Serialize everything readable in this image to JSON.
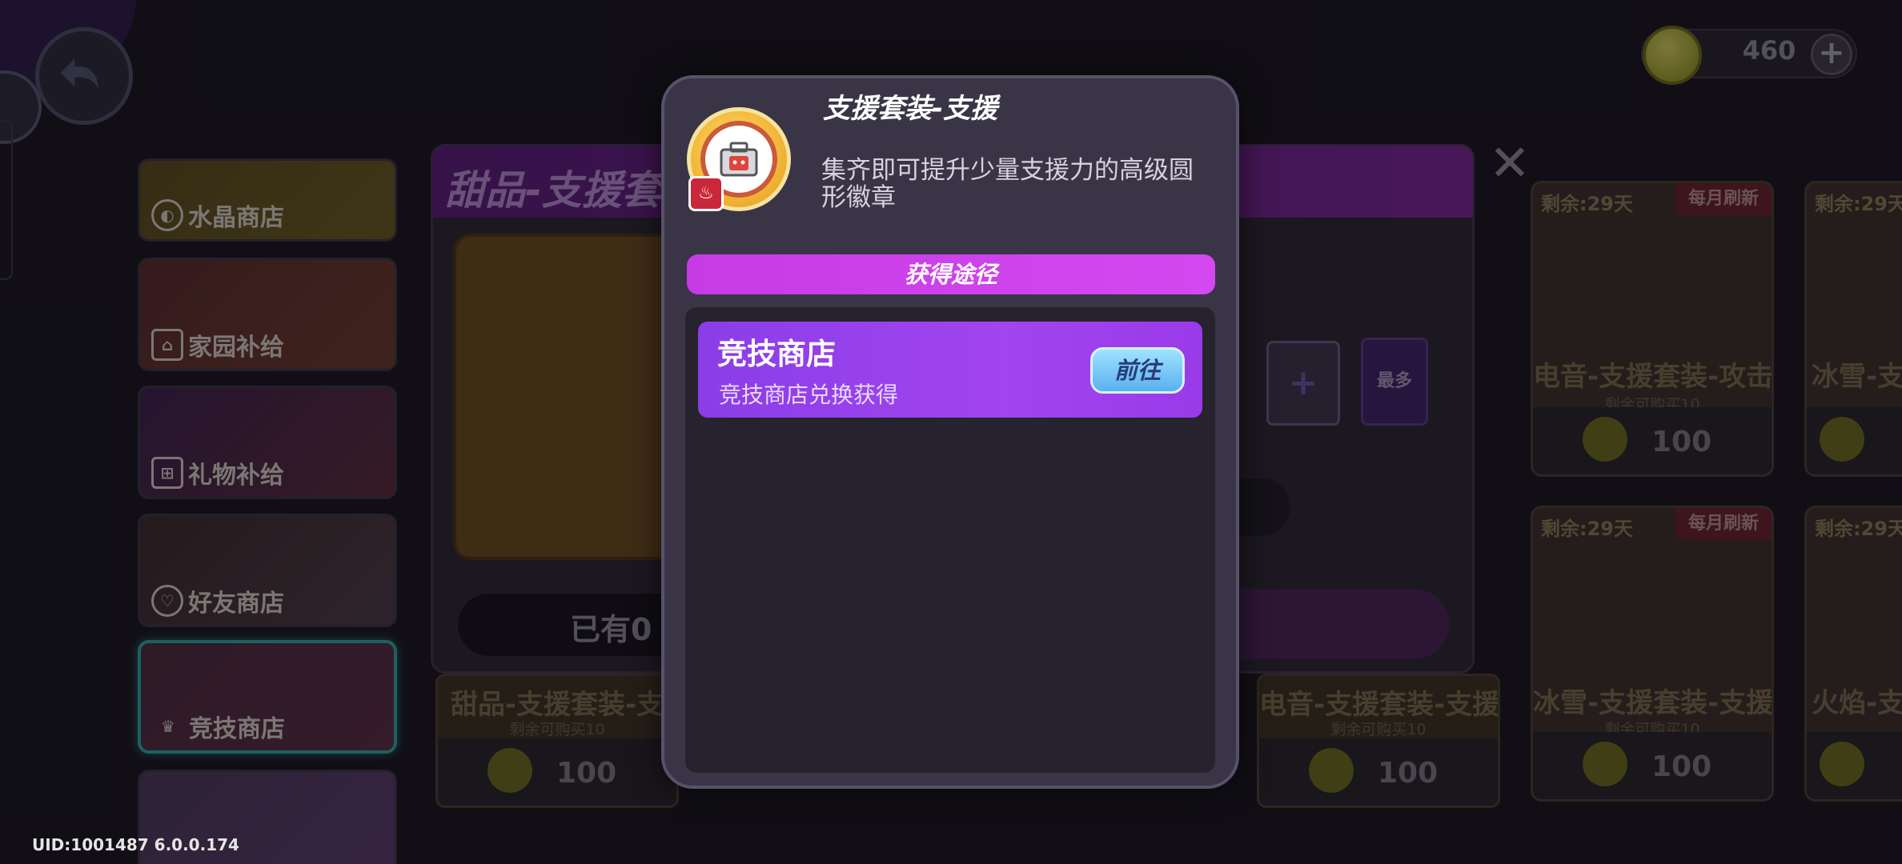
{
  "header": {
    "currency_value": "460",
    "add_currency_label": "+"
  },
  "sidebar": {
    "items": [
      {
        "label": "水晶商店",
        "icon": "crystal-icon"
      },
      {
        "label": "家园补给",
        "icon": "home-icon"
      },
      {
        "label": "礼物补给",
        "icon": "gift-icon"
      },
      {
        "label": "好友商店",
        "icon": "friend-icon"
      },
      {
        "label": "竞技商店",
        "icon": "arena-icon"
      }
    ]
  },
  "purchase_panel": {
    "title": "甜品-支援套",
    "owned_text": "已有0",
    "plus_label": "+",
    "max_label": "最多"
  },
  "shop_cards": [
    {
      "days": "剩余:29天",
      "tag": "每月刷新",
      "name": "电音-支援套装-攻击",
      "limit": "剩余可购买10",
      "price": "100"
    },
    {
      "days": "剩余:29天",
      "tag": "",
      "name": "冰雪-支",
      "limit": "",
      "price": ""
    },
    {
      "days": "剩余:29天",
      "tag": "每月刷新",
      "name": "冰雪-支援套装-支援",
      "limit": "剩余可购买10",
      "price": "100"
    },
    {
      "days": "剩余:29天",
      "tag": "",
      "name": "火焰-支",
      "limit": "",
      "price": ""
    }
  ],
  "bottom_cards": [
    {
      "name": "甜品-支援套装-支",
      "limit": "剩余可购买10",
      "price": "100"
    },
    {
      "name": "电音-支援套装-支援",
      "limit": "剩余可购买10",
      "price": "100"
    }
  ],
  "modal": {
    "title": "支援套装-支援",
    "description": "集齐即可提升少量支援力的高级圆形徽章",
    "section_header": "获得途径",
    "sources": [
      {
        "name": "竞技商店",
        "subtitle": "竞技商店兑换获得",
        "button_label": "前往"
      }
    ]
  },
  "footer": {
    "uid_text": "UID:1001487 6.0.0.174"
  },
  "colors": {
    "accent_purple": "#c63be6",
    "source_card": "#a244f0",
    "goto_button": "#5ab0f0"
  }
}
